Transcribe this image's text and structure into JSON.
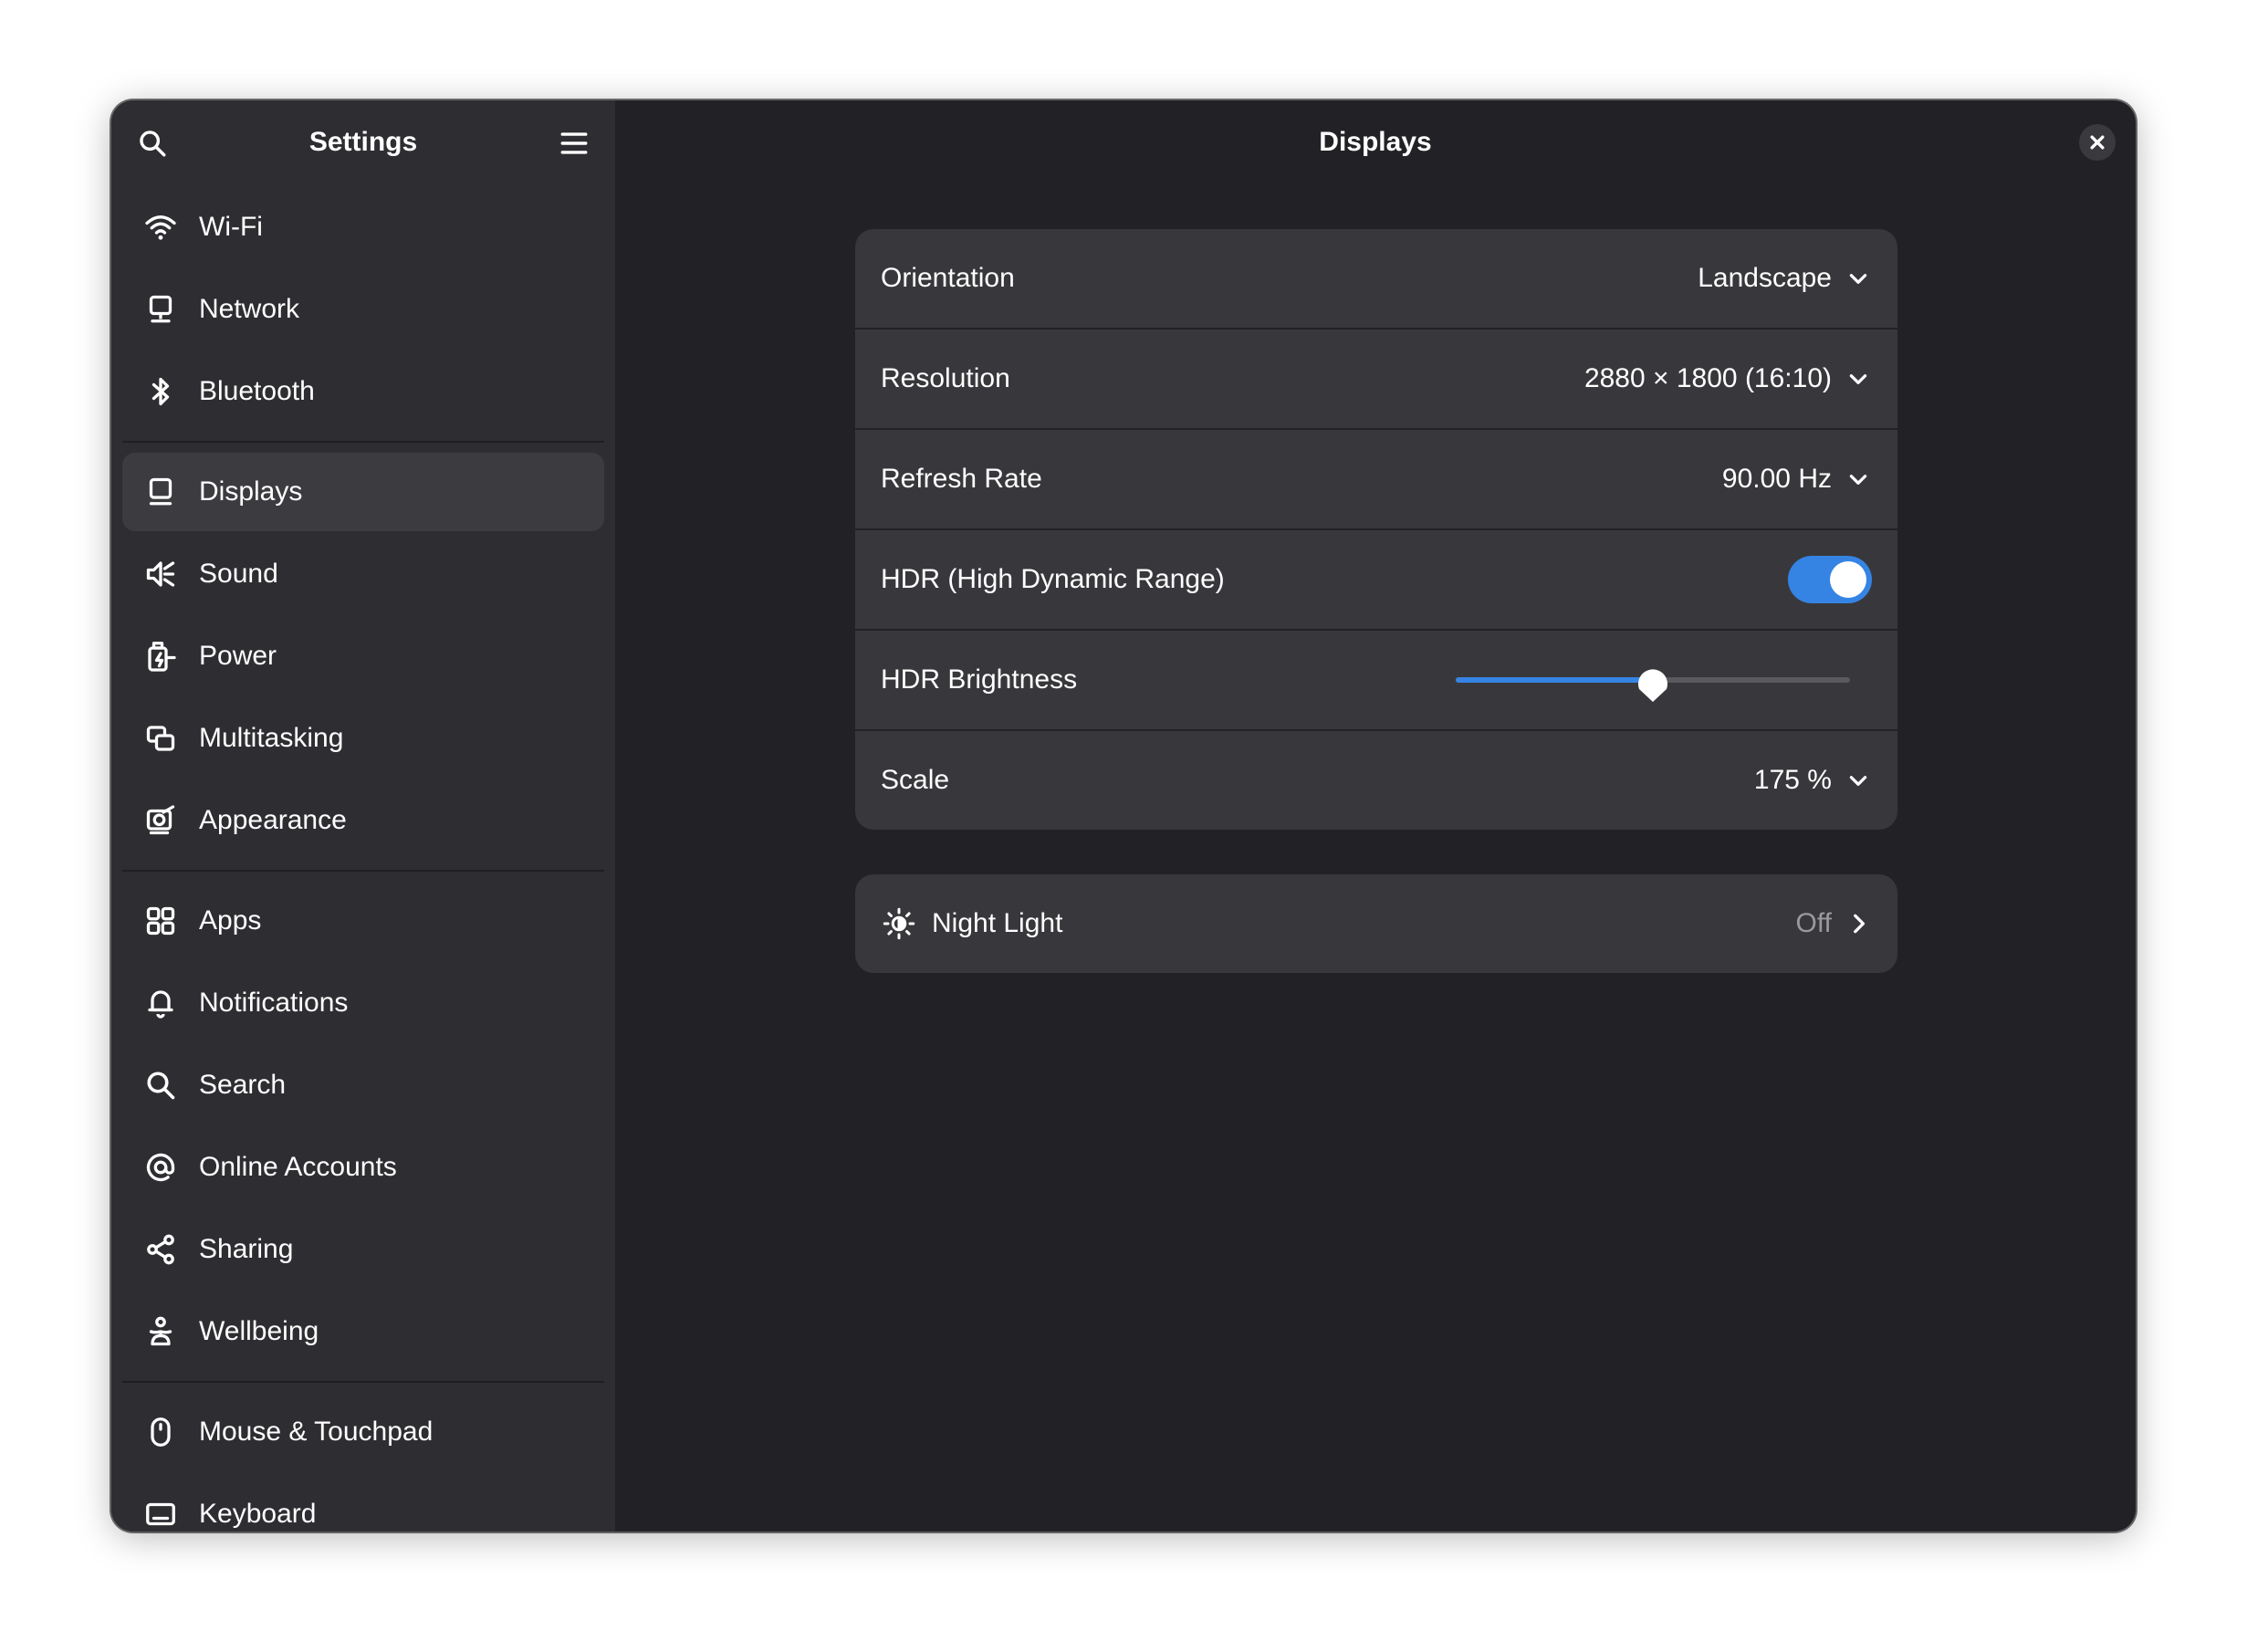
{
  "sidebar": {
    "title": "Settings",
    "items": [
      {
        "label": "Wi-Fi",
        "icon": "wifi-icon"
      },
      {
        "label": "Network",
        "icon": "network-icon"
      },
      {
        "label": "Bluetooth",
        "icon": "bluetooth-icon"
      },
      {
        "label": "Displays",
        "icon": "display-icon",
        "selected": true
      },
      {
        "label": "Sound",
        "icon": "sound-icon"
      },
      {
        "label": "Power",
        "icon": "power-icon"
      },
      {
        "label": "Multitasking",
        "icon": "multitasking-icon"
      },
      {
        "label": "Appearance",
        "icon": "appearance-icon"
      },
      {
        "label": "Apps",
        "icon": "apps-icon"
      },
      {
        "label": "Notifications",
        "icon": "bell-icon"
      },
      {
        "label": "Search",
        "icon": "search-icon"
      },
      {
        "label": "Online Accounts",
        "icon": "at-icon"
      },
      {
        "label": "Sharing",
        "icon": "share-icon"
      },
      {
        "label": "Wellbeing",
        "icon": "wellbeing-icon"
      },
      {
        "label": "Mouse & Touchpad",
        "icon": "mouse-icon"
      },
      {
        "label": "Keyboard",
        "icon": "keyboard-icon"
      }
    ]
  },
  "main": {
    "title": "Displays",
    "settings": {
      "orientation": {
        "label": "Orientation",
        "value": "Landscape"
      },
      "resolution": {
        "label": "Resolution",
        "value": "2880 × 1800 (16:10)"
      },
      "refresh_rate": {
        "label": "Refresh Rate",
        "value": "90.00 Hz"
      },
      "hdr": {
        "label": "HDR (High Dynamic Range)",
        "enabled": true
      },
      "hdr_brightness": {
        "label": "HDR Brightness",
        "level": 0.5
      },
      "scale": {
        "label": "Scale",
        "value": "175 %"
      }
    },
    "night_light": {
      "label": "Night Light",
      "value": "Off"
    }
  },
  "colors": {
    "accent": "#3584e4",
    "sidebar_bg": "#2e2e32",
    "content_bg": "#222226",
    "row_bg": "#38383c"
  }
}
